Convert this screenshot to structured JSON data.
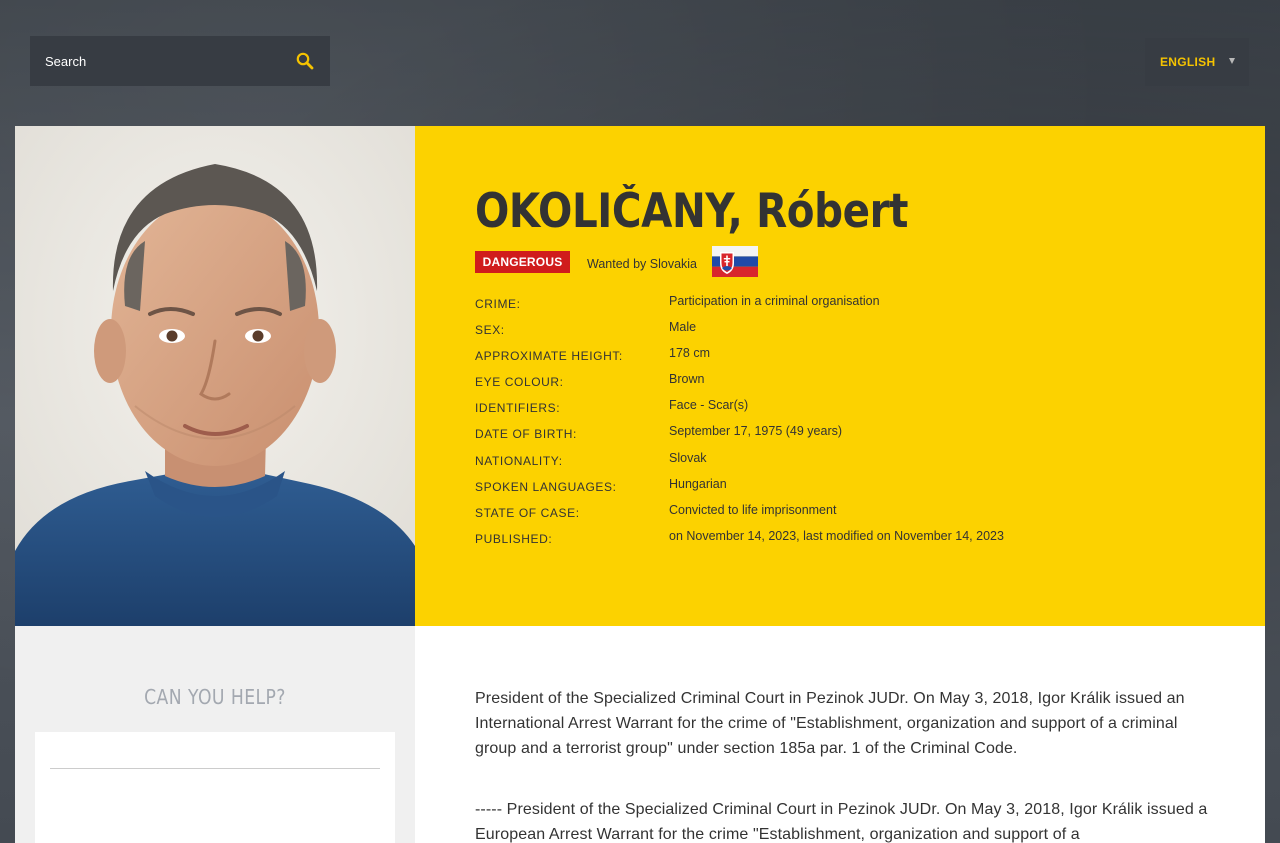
{
  "search": {
    "placeholder": "Search"
  },
  "language": {
    "selected": "ENGLISH"
  },
  "person": {
    "name": "OKOLIČANY, Róbert",
    "badge": "DANGEROUS",
    "wanted_by": "Wanted by Slovakia",
    "flag_icon": "slovakia-flag-icon",
    "details": [
      {
        "label": "Crime:",
        "value": "Participation in a criminal organisation"
      },
      {
        "label": "Sex:",
        "value": "Male"
      },
      {
        "label": "Approximate height:",
        "value": "178 cm"
      },
      {
        "label": "Eye colour:",
        "value": "Brown"
      },
      {
        "label": "Identifiers:",
        "value": "Face - Scar(s)"
      },
      {
        "label": "Date of birth:",
        "value": "September 17, 1975 (49 years)"
      },
      {
        "label": "Nationality:",
        "value": "Slovak"
      },
      {
        "label": "Spoken languages:",
        "value": "Hungarian"
      },
      {
        "label": "State of case:",
        "value": "Convicted to life imprisonment"
      },
      {
        "label": "Published:",
        "value": "on November 14, 2023, last modified on November 14, 2023"
      }
    ]
  },
  "help": {
    "title": "CAN YOU HELP?"
  },
  "description": {
    "paragraphs": [
      "President of the Specialized Criminal Court in Pezinok JUDr. On May 3, 2018, Igor Králik issued an International Arrest Warrant for the crime of \"Establishment, organization and support of a criminal group and a terrorist group\" under section 185a par. 1 of the Criminal Code.",
      "----- President of the Specialized Criminal Court in Pezinok JUDr. On May 3, 2018, Igor Králik issued a European Arrest Warrant for the crime \"Establishment, organization and support of a"
    ]
  },
  "colors": {
    "accent_yellow": "#fcd200",
    "danger_red": "#d01c1c",
    "language_text": "#f5c300",
    "search_icon": "#f5c300"
  }
}
